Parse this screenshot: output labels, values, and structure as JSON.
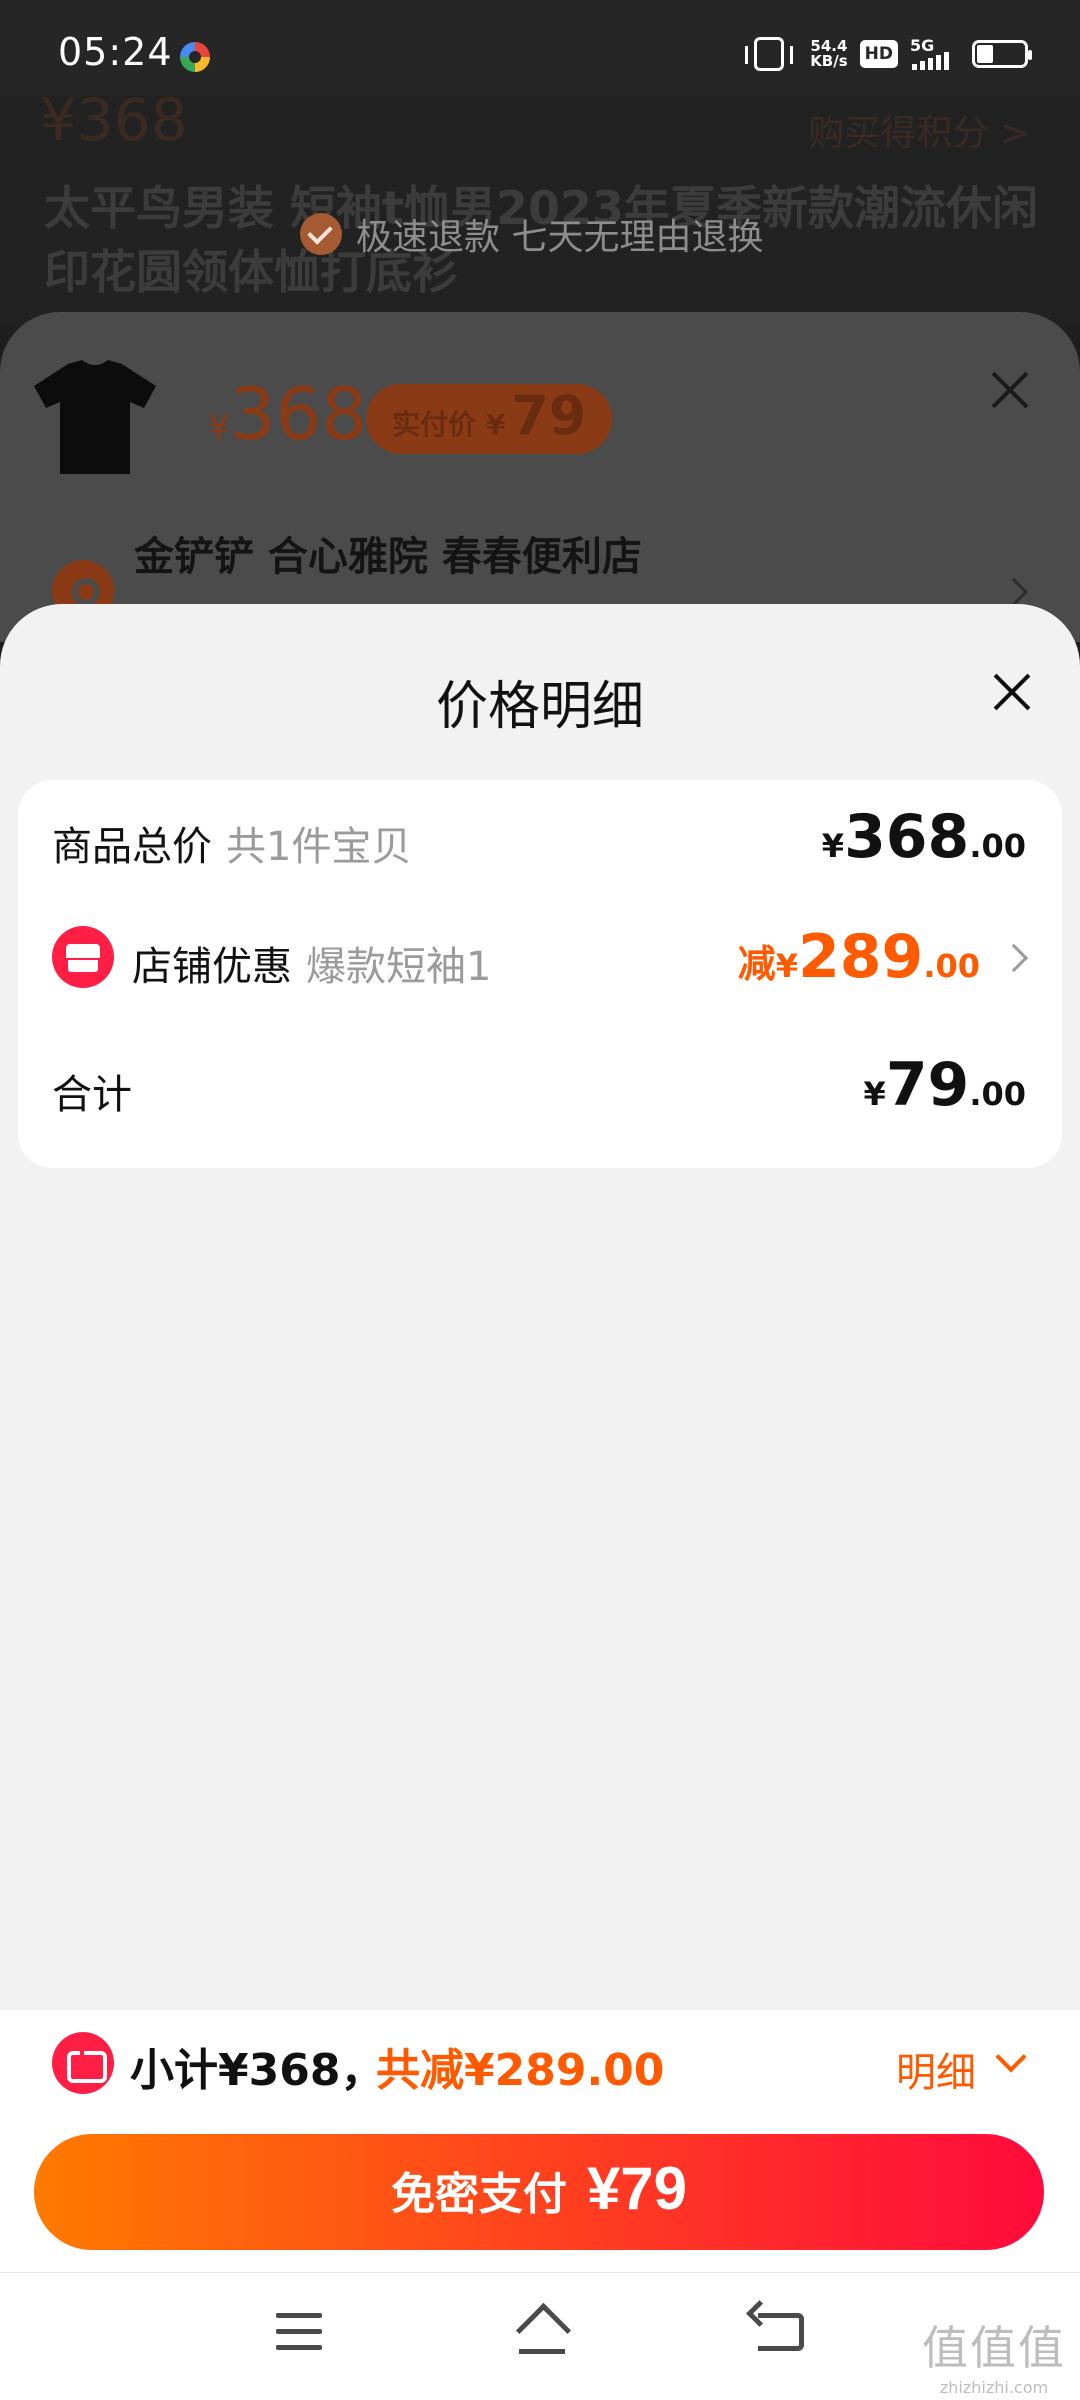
{
  "status_bar": {
    "time": "05:24",
    "net_speed_value": "54.4",
    "net_speed_unit": "KB/s",
    "hd_label": "HD",
    "network_label": "5G"
  },
  "background_page": {
    "price": "¥368",
    "points_link": "购买得积分 >",
    "title": "太平鸟男装 短袖t恤男2023年夏季新款潮流休闲印花圆领体恤打底衫",
    "toast_text": "极速退款 七天无理由退换"
  },
  "sku_sheet": {
    "price_symbol": "¥",
    "price": "368",
    "pay_label": "实付价 ¥",
    "pay_value": "79",
    "address": "金铲铲 合心雅院  春春便利店"
  },
  "price_detail": {
    "title": "价格明细",
    "rows": [
      {
        "label": "商品总价",
        "sub": "共1件宝贝",
        "prefix": "",
        "symbol": "¥",
        "int": "368",
        "dec": ".00"
      },
      {
        "label": "店铺优惠",
        "sub": "爆款短袖1",
        "prefix": "减",
        "symbol": "¥",
        "int": "289",
        "dec": ".00"
      },
      {
        "label": "合计",
        "sub": "",
        "prefix": "",
        "symbol": "¥",
        "int": "79",
        "dec": ".00"
      }
    ]
  },
  "bottom_bar": {
    "subtotal": "小计¥368，",
    "total_reduce": "共减¥289.00",
    "detail_link": "明细",
    "pay_button_label": "免密支付",
    "pay_button_amount": "¥79"
  },
  "watermark": {
    "text": "值值值",
    "domain": "zhizhizhi.com"
  },
  "colors": {
    "accent_orange": "#ff5a00",
    "accent_red": "#ff1f45",
    "gradient_start": "#ff7a00",
    "gradient_end": "#ff0a3c"
  },
  "icons": [
    "vibrate-icon",
    "battery-icon",
    "shop-coupon-icon",
    "ticket-icon",
    "close-icon",
    "chevron-right-icon",
    "chevron-down-icon",
    "nav-menu-icon",
    "nav-home-icon",
    "nav-back-icon"
  ]
}
